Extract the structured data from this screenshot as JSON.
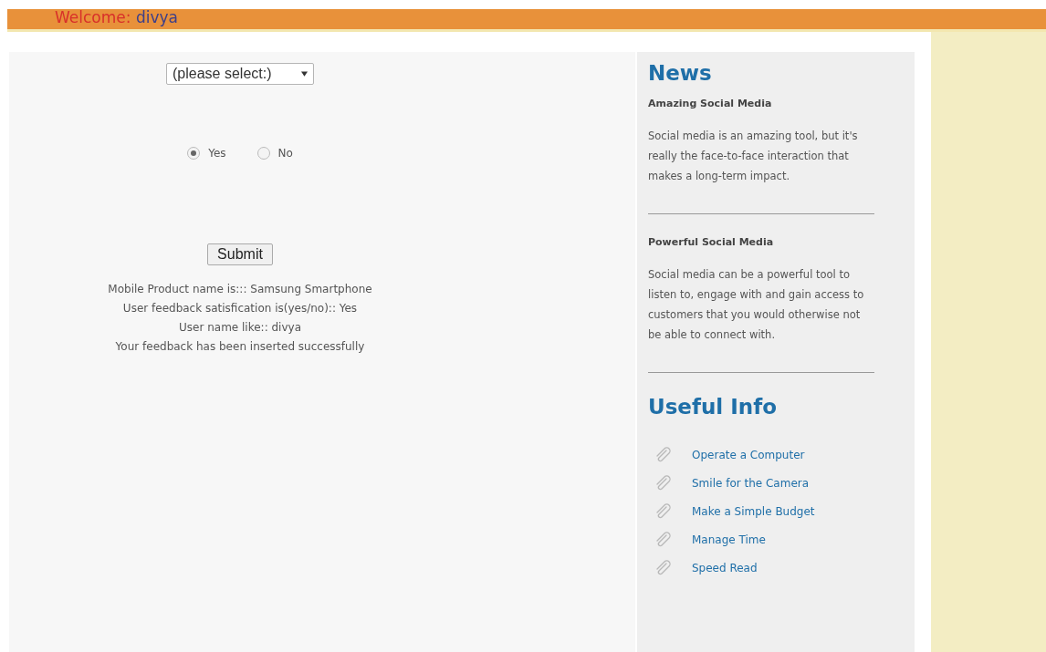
{
  "header": {
    "welcome_label": "Welcome:",
    "user_name": "divya"
  },
  "form": {
    "product_select": {
      "value": "(please select:)"
    },
    "satisfaction": [
      {
        "label": "Yes",
        "selected": true
      },
      {
        "label": "No",
        "selected": false
      }
    ],
    "submit_button": "Submit",
    "results": [
      "Mobile Product name is::: Samsung Smartphone",
      "User feedback satisfication is(yes/no):: Yes",
      "User name like:: divya",
      "Your feedback has been inserted successfully"
    ]
  },
  "sidebar": {
    "news_title": "News",
    "news": [
      {
        "heading": "Amazing Social Media",
        "text": "Social media is an amazing tool, but it's really the face-to-face interaction that makes a long-term impact."
      },
      {
        "heading": "Powerful Social Media",
        "text": "Social media can be a powerful tool to listen to, engage with and gain access to customers that you would otherwise not be able to connect with."
      }
    ],
    "useful_title": "Useful Info",
    "links": [
      "Operate a Computer",
      "Smile for the Camera",
      "Make a Simple Budget",
      "Manage Time",
      "Speed Read"
    ]
  }
}
